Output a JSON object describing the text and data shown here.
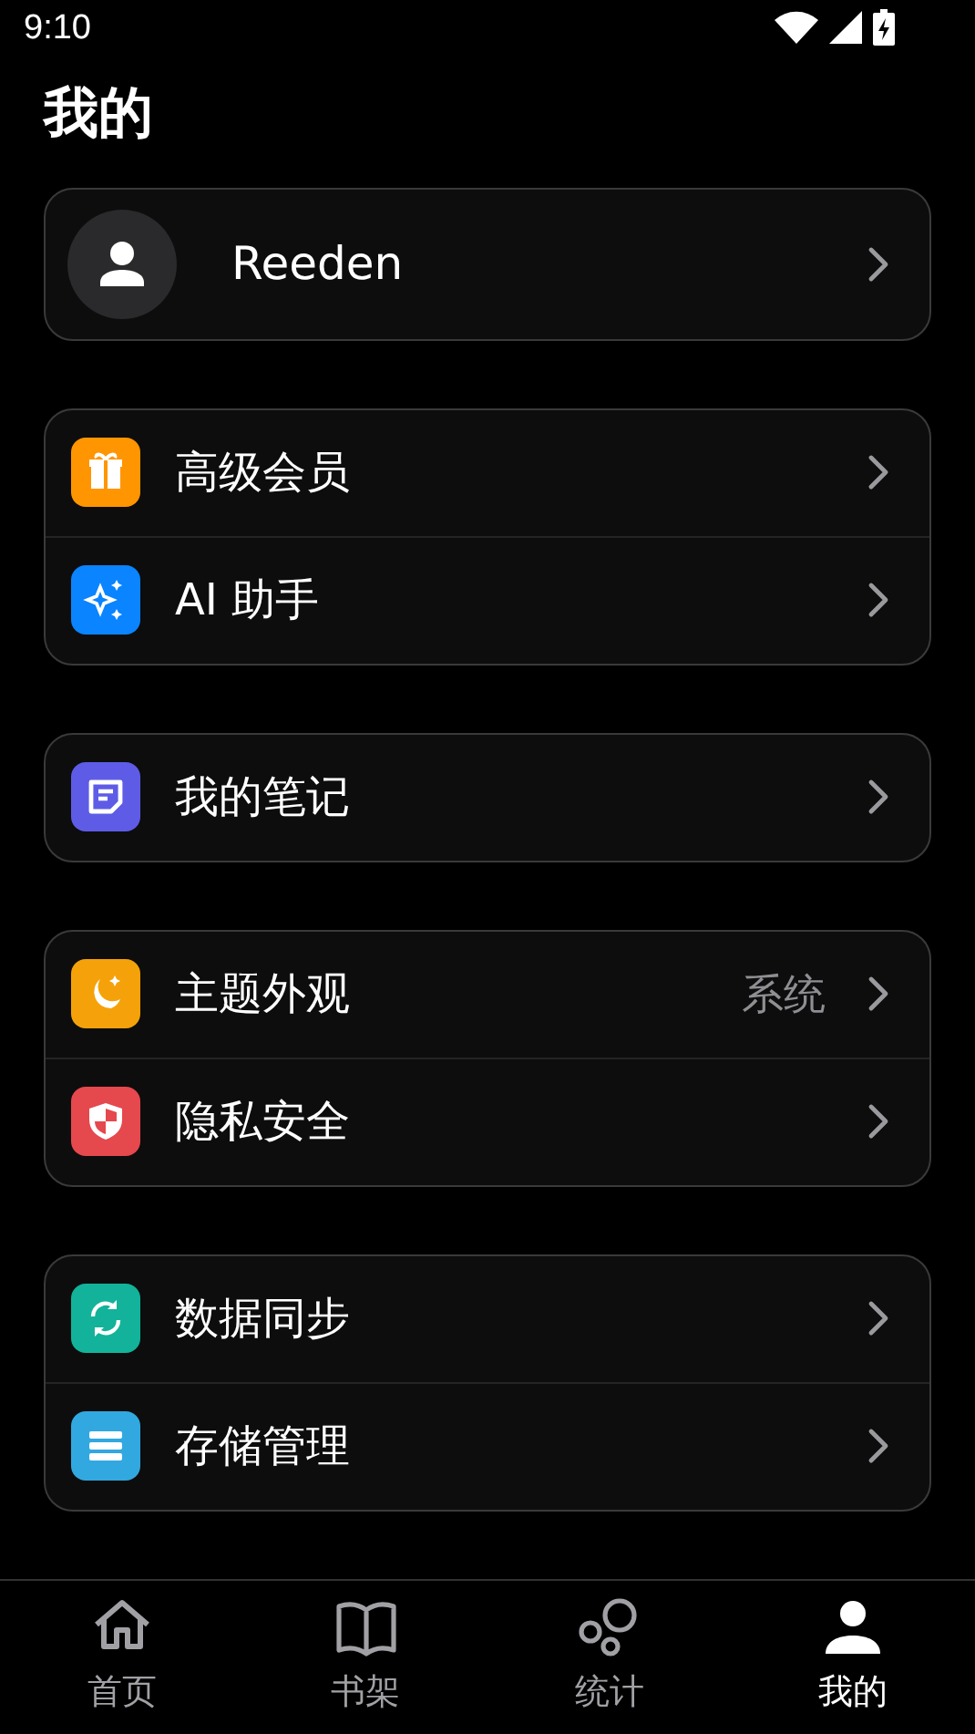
{
  "status_bar": {
    "time": "9:10"
  },
  "title": "我的",
  "profile": {
    "name": "Reeden"
  },
  "groups": [
    {
      "items": [
        {
          "label": "高级会员",
          "kind": "gift",
          "color": "#ff9500"
        },
        {
          "label": "AI 助手",
          "kind": "sparkle",
          "color": "#0a84ff"
        }
      ]
    },
    {
      "items": [
        {
          "label": "我的笔记",
          "kind": "note",
          "color": "#5e5ce6"
        }
      ]
    },
    {
      "items": [
        {
          "label": "主题外观",
          "kind": "moon",
          "color": "#f5a20a",
          "value": "系统"
        },
        {
          "label": "隐私安全",
          "kind": "shield",
          "color": "#e5484d"
        }
      ]
    },
    {
      "items": [
        {
          "label": "数据同步",
          "kind": "sync",
          "color": "#12b39a"
        },
        {
          "label": "存储管理",
          "kind": "storage",
          "color": "#32a8e0"
        }
      ]
    }
  ],
  "tabs": [
    {
      "label": "首页",
      "kind": "home",
      "selected": false
    },
    {
      "label": "书架",
      "kind": "book",
      "selected": false
    },
    {
      "label": "统计",
      "kind": "bubbles",
      "selected": false
    },
    {
      "label": "我的",
      "kind": "person",
      "selected": true
    }
  ]
}
